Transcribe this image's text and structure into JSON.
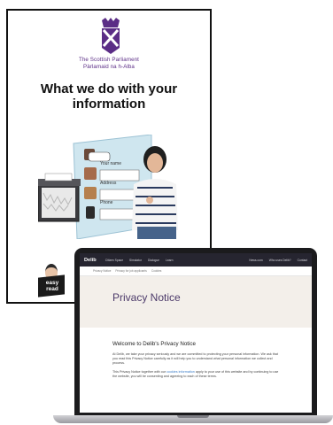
{
  "booklet": {
    "parliament_name_en": "The Scottish Parliament",
    "parliament_name_gd": "Pàrlamaid na h-Alba",
    "title": "What we do with your information",
    "easy_read_label": "easy read",
    "form_fields": [
      "Your name",
      "Address",
      "Phone"
    ]
  },
  "website": {
    "brand": "Delib",
    "nav_left": [
      "Citizen Space",
      "Simulator",
      "Dialogue",
      "Learn"
    ],
    "nav_right": [
      "News.com",
      "Who uses Delib?",
      "Contact"
    ],
    "breadcrumbs": [
      "Privacy Notice",
      "Privacy for job applicants",
      "Cookies"
    ],
    "page_title": "Privacy Notice",
    "welcome_heading": "Welcome to Delib's Privacy Notice",
    "paragraph_1": "At Delib, we take your privacy seriously and we are committed to protecting your personal information. We ask that you read this Privacy Notice carefully as it will help you to understand what personal information we collect and process.",
    "paragraph_2_before_link": "This Privacy Notice together with our ",
    "paragraph_2_link": "cookies information",
    "paragraph_2_after_link": " apply to your use of this website and by continuing to use the website, you will be consenting and agreeing to each of these terms."
  },
  "colors": {
    "parliament_purple": "#5b2d86",
    "nav_background": "#262530",
    "hero_background": "#f3efea",
    "link": "#3a7cc7"
  }
}
